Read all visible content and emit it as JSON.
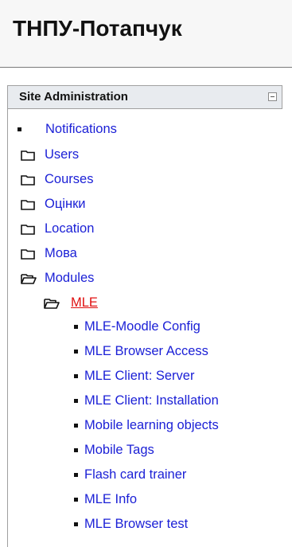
{
  "header": {
    "site_title": "ТНПУ-Потапчук"
  },
  "block": {
    "title": "Site Administration",
    "items": [
      {
        "label": "Notifications",
        "kind": "leaf"
      },
      {
        "label": "Users",
        "kind": "folder-closed"
      },
      {
        "label": "Courses",
        "kind": "folder-closed"
      },
      {
        "label": "Оцінки",
        "kind": "folder-closed"
      },
      {
        "label": "Location",
        "kind": "folder-closed"
      },
      {
        "label": "Мова",
        "kind": "folder-closed"
      },
      {
        "label": "Modules",
        "kind": "folder-open"
      },
      {
        "label": "MLE",
        "kind": "folder-open-active"
      },
      {
        "label": "MLE-Moodle Config",
        "kind": "leaf"
      },
      {
        "label": "MLE Browser Access",
        "kind": "leaf"
      },
      {
        "label": "MLE Client: Server",
        "kind": "leaf"
      },
      {
        "label": "MLE Client: Installation",
        "kind": "leaf"
      },
      {
        "label": "Mobile learning objects",
        "kind": "leaf"
      },
      {
        "label": "Mobile Tags",
        "kind": "leaf"
      },
      {
        "label": "Flash card trainer",
        "kind": "leaf"
      },
      {
        "label": "MLE Info",
        "kind": "leaf"
      },
      {
        "label": "MLE Browser test",
        "kind": "leaf"
      }
    ]
  },
  "colors": {
    "link": "#1a1fd6",
    "active": "#e01010",
    "header_bg": "#e8ebef"
  }
}
